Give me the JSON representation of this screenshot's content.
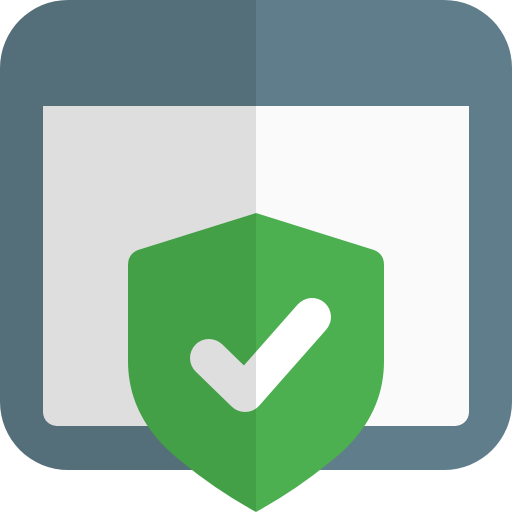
{
  "icon": {
    "name": "secure-browser-icon",
    "colors": {
      "window_frame_right": "#607D8B",
      "window_frame_left": "#546E7A",
      "page_right": "#FAFAFA",
      "page_left": "#DEDEDE",
      "shield_right": "#4CAF50",
      "shield_left": "#43A047",
      "checkmark_right": "#FFFFFF",
      "checkmark_left": "#DEDEDE"
    }
  }
}
